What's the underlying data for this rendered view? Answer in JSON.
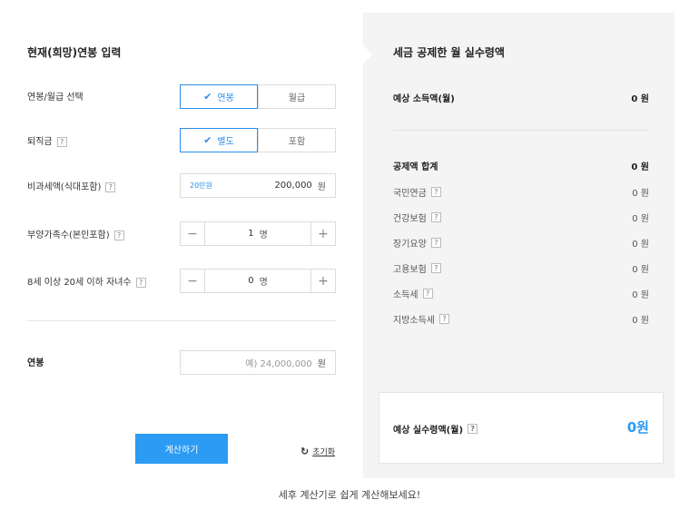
{
  "form": {
    "title": "현재(희망)연봉 입력",
    "salary_type": {
      "label": "연봉/월급 선택",
      "options": [
        "연봉",
        "월급"
      ],
      "selected": "연봉"
    },
    "severance": {
      "label": "퇴직금",
      "help": "?",
      "options": [
        "별도",
        "포함"
      ],
      "selected": "별도"
    },
    "non_taxable": {
      "label": "비과세액(식대포함)",
      "help": "?",
      "tag": "20만원",
      "value": "200,000",
      "unit": "원"
    },
    "dependents": {
      "label": "부양가족수(본인포함)",
      "help": "?",
      "value": "1",
      "unit": "명",
      "minus": "−",
      "plus": "+"
    },
    "children": {
      "label": "8세 이상 20세 이하 자녀수",
      "help": "?",
      "value": "0",
      "unit": "명",
      "minus": "−",
      "plus": "+"
    },
    "salary": {
      "label": "연봉",
      "placeholder": "예) 24,000,000",
      "unit": "원"
    },
    "calc_button": "계산하기",
    "reset": {
      "icon": "refresh-icon",
      "label": "초기화"
    }
  },
  "result": {
    "title": "세금 공제한 월 실수령액",
    "expected_income": {
      "label": "예상 소득액(월)",
      "value": "0 원"
    },
    "deduction_total": {
      "label": "공제액 합계",
      "value": "0 원"
    },
    "items": [
      {
        "label": "국민연금",
        "help": "?",
        "value": "0 원"
      },
      {
        "label": "건강보험",
        "help": "?",
        "value": "0 원"
      },
      {
        "label": "장기요양",
        "help": "?",
        "value": "0 원"
      },
      {
        "label": "고용보험",
        "help": "?",
        "value": "0 원"
      },
      {
        "label": "소득세",
        "help": "?",
        "value": "0 원"
      },
      {
        "label": "지방소득세",
        "help": "?",
        "value": "0 원"
      }
    ],
    "net": {
      "label": "예상 실수령액(월)",
      "help": "?",
      "value": "0원"
    }
  },
  "footer": "세후 계산기로 쉽게 계산해보세요!",
  "colors": {
    "accent": "#2b9bf4",
    "panel_bg": "#f4f4f4"
  }
}
